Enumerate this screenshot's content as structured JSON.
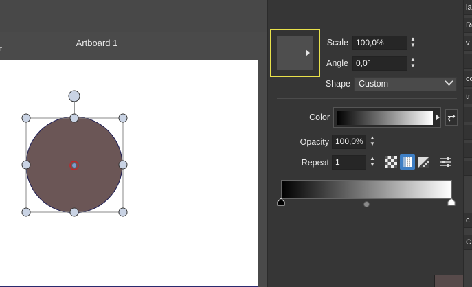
{
  "artboard": {
    "title": "Artboard 1",
    "edge_mark": "t"
  },
  "gradient_panel": {
    "preview_icon": "triangle-right-icon",
    "scale": {
      "label": "Scale",
      "value": "100,0%"
    },
    "angle": {
      "label": "Angle",
      "value": "0,0°"
    },
    "shape": {
      "label": "Shape",
      "value": "Custom"
    },
    "color": {
      "label": "Color",
      "start": "#000000",
      "end": "#ffffff",
      "swap_icon": "swap-icon"
    },
    "opacity": {
      "label": "Opacity",
      "value": "100,0%"
    },
    "repeat": {
      "label": "Repeat",
      "value": "1"
    },
    "tools": [
      "checkerboard-icon",
      "dither-icon",
      "pattern-icon",
      "sliders-icon"
    ],
    "ramp": {
      "start": "#000000",
      "end": "#ffffff",
      "midpoint": 0.5
    }
  },
  "right_strip": {
    "items": [
      "ia",
      "Ro",
      "v",
      "",
      "co",
      "tr",
      "",
      "",
      "",
      "",
      "c",
      "C"
    ]
  },
  "colors": {
    "accent": "#e8e14b",
    "shape_fill": "#6b5656",
    "selection_handle": "#c9d3e4"
  }
}
